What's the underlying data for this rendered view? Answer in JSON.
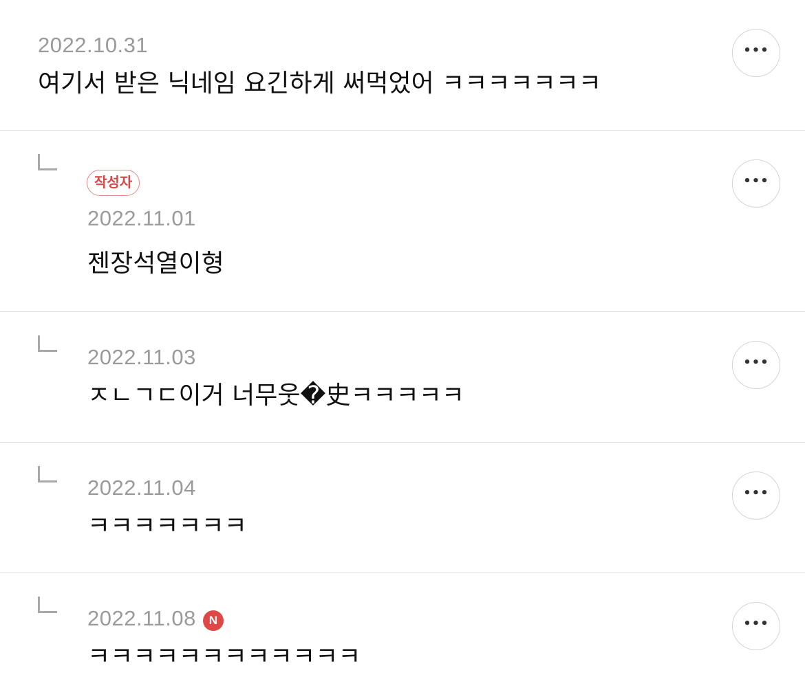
{
  "comments": [
    {
      "date": "2022.10.31",
      "text": "여기서 받은 닉네임 요긴하게 써먹었어 ㅋㅋㅋㅋㅋㅋㅋ",
      "more_label": "•••"
    },
    {
      "badge": "작성자",
      "date": "2022.11.01",
      "text": "젠장석열이형",
      "more_label": "•••"
    },
    {
      "date": "2022.11.03",
      "text": "ㅈㄴㄱㄷ이거 너무웃�史ㅋㅋㅋㅋㅋ",
      "more_label": "•••"
    },
    {
      "date": "2022.11.04",
      "text": "ㅋㅋㅋㅋㅋㅋㅋ",
      "more_label": "•••"
    },
    {
      "date": "2022.11.08",
      "new_badge": "N",
      "text": "ㅋㅋㅋㅋㅋㅋㅋㅋㅋㅋㅋㅋ",
      "more_label": "•••"
    }
  ],
  "colors": {
    "date": "#9a9a9a",
    "text": "#111111",
    "author_badge": "#d24a4a",
    "new_badge": "#e04848",
    "divider": "#dcdcdc"
  }
}
